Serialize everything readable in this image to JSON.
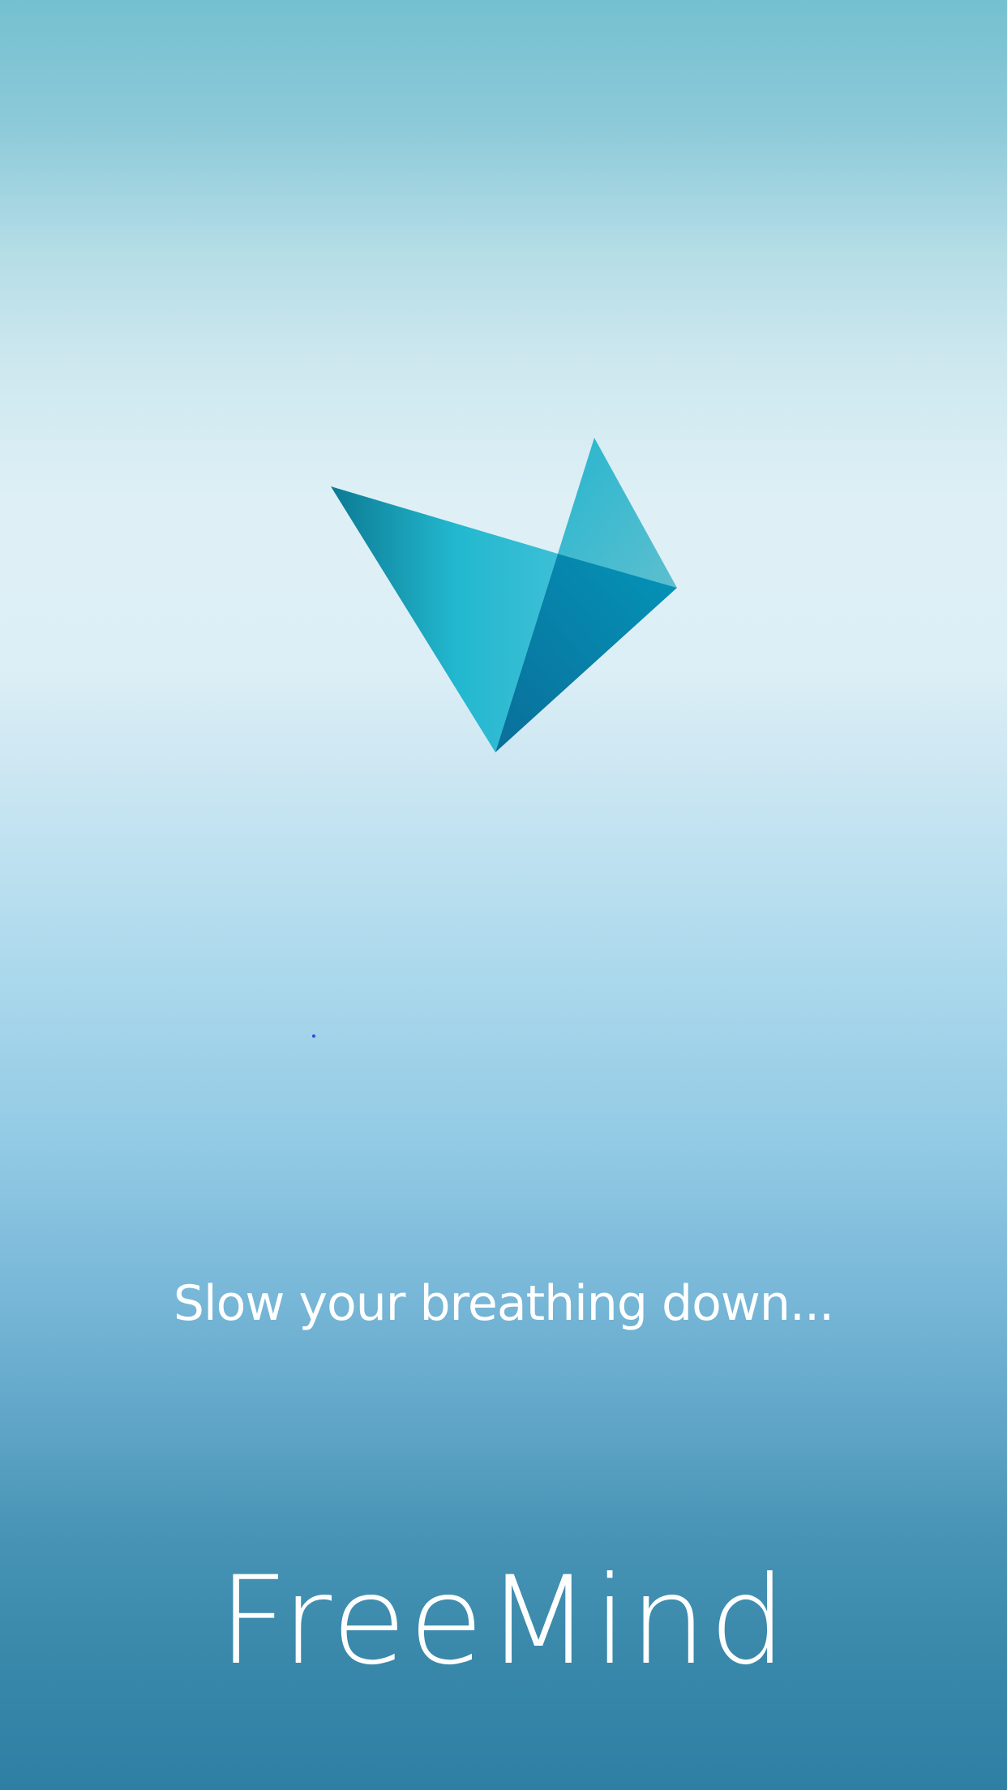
{
  "splash": {
    "tagline": "Slow your breathing down...",
    "brand_name": "FreeMind",
    "logo_icon": "triangle-bird-logo",
    "colors": {
      "logo_teal_light": "#3cc2d6",
      "logo_teal_dark": "#0b7fa3",
      "text": "#ffffff"
    }
  }
}
